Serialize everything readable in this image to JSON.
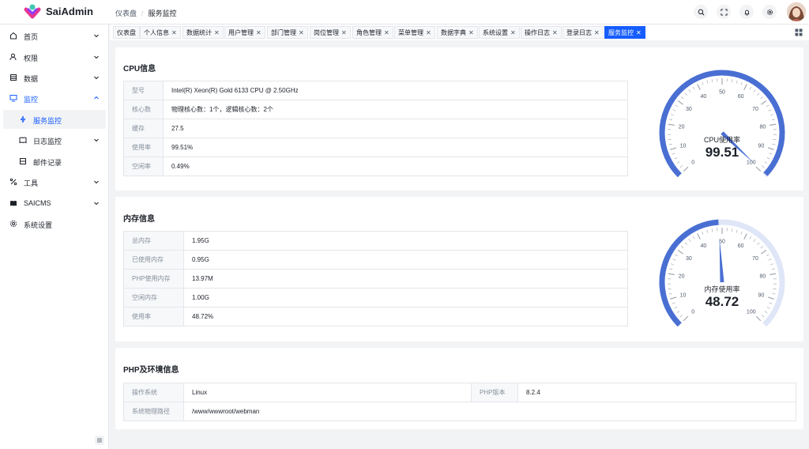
{
  "app": {
    "brand": "SaiAdmin"
  },
  "breadcrumb": [
    "仪表盘",
    "服务监控"
  ],
  "sidebar": {
    "items": [
      {
        "label": "首页",
        "icon": "home-icon",
        "has_children": true
      },
      {
        "label": "权限",
        "icon": "user-icon",
        "has_children": true
      },
      {
        "label": "数据",
        "icon": "database-icon",
        "has_children": true
      },
      {
        "label": "监控",
        "icon": "monitor-icon",
        "has_children": true,
        "open": true
      },
      {
        "label": "服务监控",
        "icon": "thunder-icon",
        "sub": true,
        "active": true
      },
      {
        "label": "日志监控",
        "icon": "book-icon",
        "sub": true,
        "has_children": true
      },
      {
        "label": "邮件记录",
        "icon": "mail-icon",
        "sub": true
      },
      {
        "label": "工具",
        "icon": "tool-icon",
        "has_children": true
      },
      {
        "label": "SAICMS",
        "icon": "cms-icon",
        "has_children": true
      },
      {
        "label": "系统设置",
        "icon": "settings-icon"
      }
    ]
  },
  "tabs": [
    {
      "label": "仪表盘",
      "closable": false
    },
    {
      "label": "个人信息",
      "closable": true
    },
    {
      "label": "数据统计",
      "closable": true
    },
    {
      "label": "用户管理",
      "closable": true
    },
    {
      "label": "部门管理",
      "closable": true
    },
    {
      "label": "岗位管理",
      "closable": true
    },
    {
      "label": "角色管理",
      "closable": true
    },
    {
      "label": "菜单管理",
      "closable": true
    },
    {
      "label": "数据字典",
      "closable": true
    },
    {
      "label": "系统设置",
      "closable": true
    },
    {
      "label": "操作日志",
      "closable": true
    },
    {
      "label": "登录日志",
      "closable": true
    },
    {
      "label": "服务监控",
      "closable": true,
      "active": true
    }
  ],
  "cpu": {
    "title": "CPU信息",
    "rows": [
      {
        "label": "型号",
        "value": "Intel(R) Xeon(R) Gold 6133 CPU @ 2.50GHz"
      },
      {
        "label": "核心数",
        "value": "物理核心数：1个，逻辑核心数：2个"
      },
      {
        "label": "缓存",
        "value": "27.5"
      },
      {
        "label": "使用率",
        "value": "99.51%"
      },
      {
        "label": "空闲率",
        "value": "0.49%"
      }
    ],
    "gauge": {
      "label": "CPU使用率",
      "value_text": "99.51",
      "value": 99.51
    }
  },
  "memory": {
    "title": "内存信息",
    "rows": [
      {
        "label": "总内存",
        "value": "1.95G"
      },
      {
        "label": "已使用内存",
        "value": "0.95G"
      },
      {
        "label": "PHP使用内存",
        "value": "13.97M"
      },
      {
        "label": "空闲内存",
        "value": "1.00G"
      },
      {
        "label": "使用率",
        "value": "48.72%"
      }
    ],
    "gauge": {
      "label": "内存使用率",
      "value_text": "48.72",
      "value": 48.72
    }
  },
  "php": {
    "title": "PHP及环境信息",
    "os_label": "操作系统",
    "os_value": "Linux",
    "php_label": "PHP版本",
    "php_value": "8.2.4",
    "path_label": "系统物理路径",
    "path_value": "/www/wwwroot/webman"
  },
  "gauge_ticks": [
    "0",
    "10",
    "20",
    "30",
    "40",
    "50",
    "60",
    "70",
    "80",
    "90",
    "100"
  ],
  "colors": {
    "accent": "#165dff",
    "gauge": "#4a6fd3",
    "gauge_track": "#dfe6f7"
  }
}
